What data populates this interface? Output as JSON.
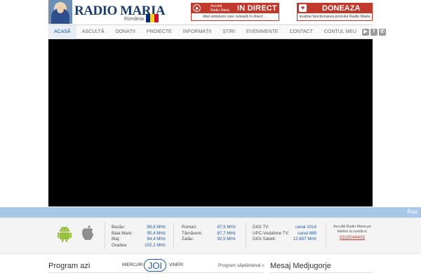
{
  "header": {
    "logo_text": "RADIO MARIA",
    "logo_sub": "România",
    "direct": {
      "small_line1": "Ascultă",
      "small_line2": "Radio Maria",
      "label": "IN DIRECT",
      "caption": "titlul emisiunii care rulează în direct ..."
    },
    "donate": {
      "label": "DONEAZA",
      "caption": "susține funcționarea postului Radio Maria"
    },
    "colors": {
      "brand_blue": "#1d3c6e",
      "accent_red": "#c0392b",
      "flag": [
        "#002b7f",
        "#fcd116",
        "#ce1126"
      ]
    }
  },
  "nav": {
    "items": [
      "ACASĂ",
      "ASCULTĂ",
      "DONAȚII",
      "PROIECTE",
      "INFORMAȚII",
      "ȘTIRI",
      "EVENIMENTE",
      "CONTACT",
      "CONTUL MEU"
    ],
    "socials": [
      "youtube-icon",
      "facebook-icon",
      "whatsapp-icon"
    ]
  },
  "ticker": {
    "text": "Rad"
  },
  "frequencies": {
    "col1": [
      {
        "city": "Bacău:",
        "freq": "89,6 MHz"
      },
      {
        "city": "Baia Mare:",
        "freq": "95,4 MHz"
      },
      {
        "city": "Blaj:",
        "freq": "94,4 MHz"
      },
      {
        "city": "Oradea:",
        "freq": "102,2 MHz"
      }
    ],
    "col2": [
      {
        "city": "Roman:",
        "freq": "87,9 MHz"
      },
      {
        "city": "Târnăveni:",
        "freq": "87,7 MHz"
      },
      {
        "city": "Zalău:",
        "freq": "92,5 MHz"
      }
    ],
    "col3": [
      {
        "name": "DIGI TV:",
        "channel": "canal 1014"
      },
      {
        "name": "UPC-Vodafone TV:",
        "channel": "canal 889"
      },
      {
        "name": "DIGI Satelit:",
        "channel": "12.687 MHz"
      }
    ],
    "phone": {
      "line1": "Ascultă Radio Maria pe",
      "line2": "telefon la numărul:",
      "number": "0315040405"
    }
  },
  "program": {
    "title": "Program azi",
    "prev_day": "MIERCURI",
    "current_day": "JOI",
    "next_day": "VINERI",
    "weekly_link": "Program săptămânal »"
  },
  "medjugorje": {
    "title": "Mesaj Medjugorje"
  }
}
